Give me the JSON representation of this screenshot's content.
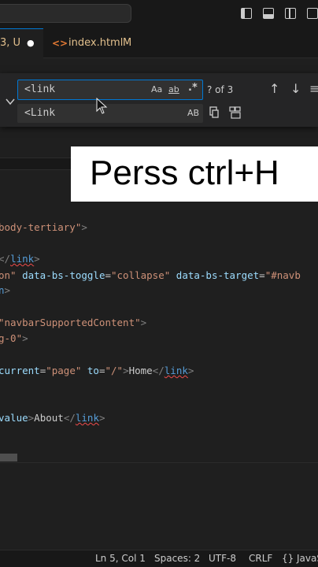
{
  "tabs": [
    {
      "label": "3, U",
      "dot": "●"
    },
    {
      "icon": "<>",
      "label": "index.html",
      "status": "M"
    }
  ],
  "find": {
    "value": "<link",
    "match_case": "Aa",
    "whole_word": "ab",
    "regex": ".*",
    "result": "? of 3",
    "prev": "↑",
    "next": "↓",
    "menu": "≡"
  },
  "replace": {
    "value": "<Link",
    "preserve_case": "AB"
  },
  "overlay": {
    "text": "Perss ctrl+H"
  },
  "code_lines": [
    "body-tertiary\">",
    "</link>",
    "on\" data-bs-toggle=\"collapse\" data-bs-target=\"#navb",
    "n>",
    "\"navbarSupportedContent\">",
    "g-0\">",
    "current=\"page\" to=\"/\">Home</link>",
    "value>About</link>"
  ],
  "status": {
    "position": "Ln 5, Col 1",
    "spaces": "Spaces: 2",
    "encoding": "UTF-8",
    "eol": "CRLF",
    "braces": "{}",
    "language": "JavaS"
  },
  "colors": {
    "accent": "#0078d4",
    "modified": "#e2c08d",
    "untracked": "#73c991"
  }
}
